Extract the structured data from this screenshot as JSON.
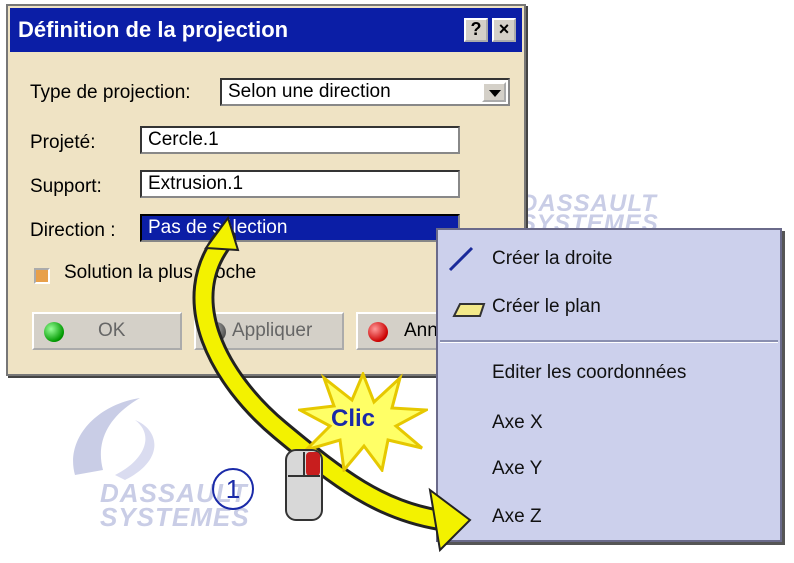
{
  "dialog": {
    "title": "Définition de la projection",
    "help_label": "?",
    "close_label": "×",
    "type_label": "Type de projection:",
    "type_value": "Selon une direction",
    "projete_label": "Projeté:",
    "projete_value": "Cercle.1",
    "support_label": "Support:",
    "support_value": "Extrusion.1",
    "direction_label": "Direction :",
    "direction_value": "Pas de sélection",
    "checkbox_label": "Solution la plus proche",
    "ok_label": "OK",
    "apply_label": "Appliquer",
    "cancel_label": "Annuler"
  },
  "menu": {
    "items": [
      {
        "label": "Créer la droite"
      },
      {
        "label": "Créer le plan"
      },
      {
        "label": "Editer les coordonnées"
      },
      {
        "label": "Axe X"
      },
      {
        "label": "Axe Y"
      },
      {
        "label": "Axe Z"
      }
    ]
  },
  "callout": {
    "clic": "Clic",
    "step": "1"
  },
  "watermark": {
    "brand1": "DASSAULT",
    "brand2": "SYSTEMES"
  },
  "colors": {
    "titlebar": "#0b1ea6",
    "dialog_bg": "#efe3c4",
    "menu_bg": "#ccd0ec",
    "arrow": "#f3f200"
  }
}
